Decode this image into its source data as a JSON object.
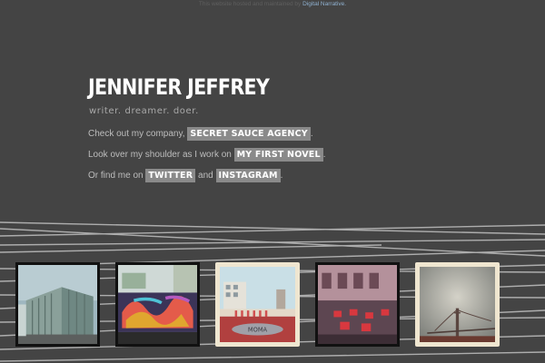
{
  "topbar": {
    "prefix": "This website hosted and maintained by",
    "link": "Digital Narrative."
  },
  "header": {
    "name": "JENNIFER JEFFREY",
    "tagline": "writer. dreamer. doer."
  },
  "links": {
    "line1_prefix": "Check out my company,",
    "company": "SECRET SAUCE AGENCY",
    "line1_suffix": ".",
    "line2_prefix": "Look over my shoulder as I work on",
    "novel": "MY FIRST NOVEL",
    "line2_suffix": ".",
    "line3_prefix": "Or find me on",
    "twitter": "TWITTER",
    "and": "and",
    "instagram": "INSTAGRAM",
    "line3_suffix": "."
  },
  "photos": [
    {
      "subject": "building photo",
      "icon": "building-photo"
    },
    {
      "subject": "graffiti photo",
      "icon": "graffiti-photo"
    },
    {
      "subject": "plaza photo",
      "icon": "plaza-photo"
    },
    {
      "subject": "cafe photo",
      "icon": "cafe-photo"
    },
    {
      "subject": "bridge photo",
      "icon": "bridge-photo"
    }
  ],
  "colors": {
    "background": "#444444",
    "highlight": "#8a8a8a",
    "link": "#8fb0cf"
  }
}
